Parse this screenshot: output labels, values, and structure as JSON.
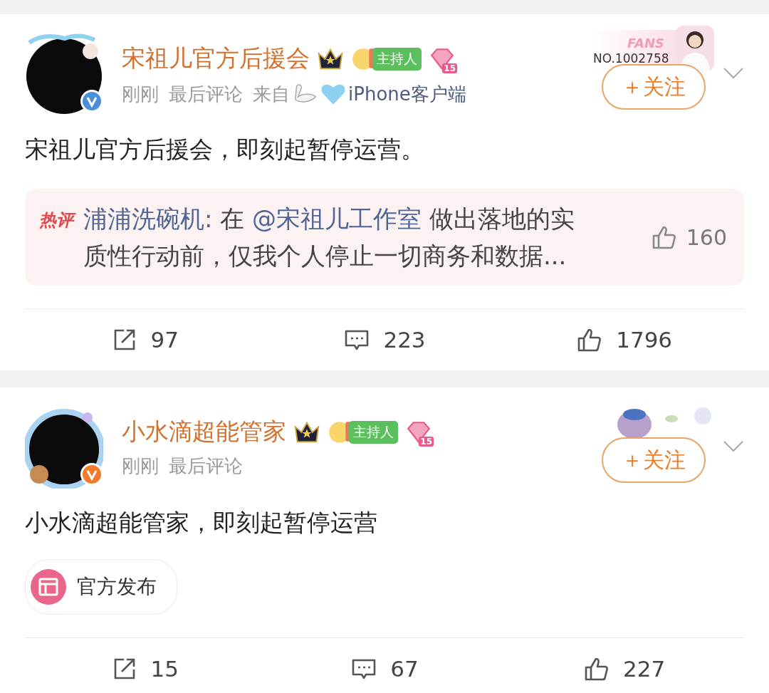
{
  "posts": [
    {
      "author": {
        "name": "宋祖儿官方后援会",
        "verified_badge": {
          "color": "#4a90d9"
        }
      },
      "badges": [
        {
          "kind": "crown"
        },
        {
          "kind": "host",
          "label": "主持人"
        },
        {
          "kind": "level",
          "label": "15"
        }
      ],
      "decoration": {
        "kind": "fans_card",
        "title": "FANS",
        "number": "NO.1002758"
      },
      "follow": {
        "label": "＋关注"
      },
      "meta": {
        "time": "刚刚",
        "note": "最后评论",
        "source_prefix": "来自",
        "source": "iPhone客户端"
      },
      "text": "宋祖儿官方后援会，即刻起暂停运营。",
      "hot_comment": {
        "tag": "热评",
        "author": "浦浦洗碗机:",
        "parts": [
          {
            "kind": "plain",
            "text": " 在 "
          },
          {
            "kind": "mention",
            "text": "@宋祖儿工作室"
          },
          {
            "kind": "plain",
            "text": " 做出落地的实质性行动前，仅我个人停止一切商务和数据..."
          }
        ],
        "likes": "160"
      },
      "actions": {
        "reposts": "97",
        "comments": "223",
        "likes": "1796"
      }
    },
    {
      "author": {
        "name": "小水滴超能管家",
        "verified_badge": {
          "color": "#f07b2c"
        }
      },
      "badges": [
        {
          "kind": "crown"
        },
        {
          "kind": "host",
          "label": "主持人"
        },
        {
          "kind": "level",
          "label": "15"
        }
      ],
      "decoration": {
        "kind": "stickers"
      },
      "follow": {
        "label": "＋关注"
      },
      "meta": {
        "time": "刚刚",
        "note": "最后评论"
      },
      "text": "小水滴超能管家，即刻起暂停运营",
      "tag": {
        "label": "官方发布"
      },
      "actions": {
        "reposts": "15",
        "comments": "67",
        "likes": "227"
      }
    }
  ]
}
